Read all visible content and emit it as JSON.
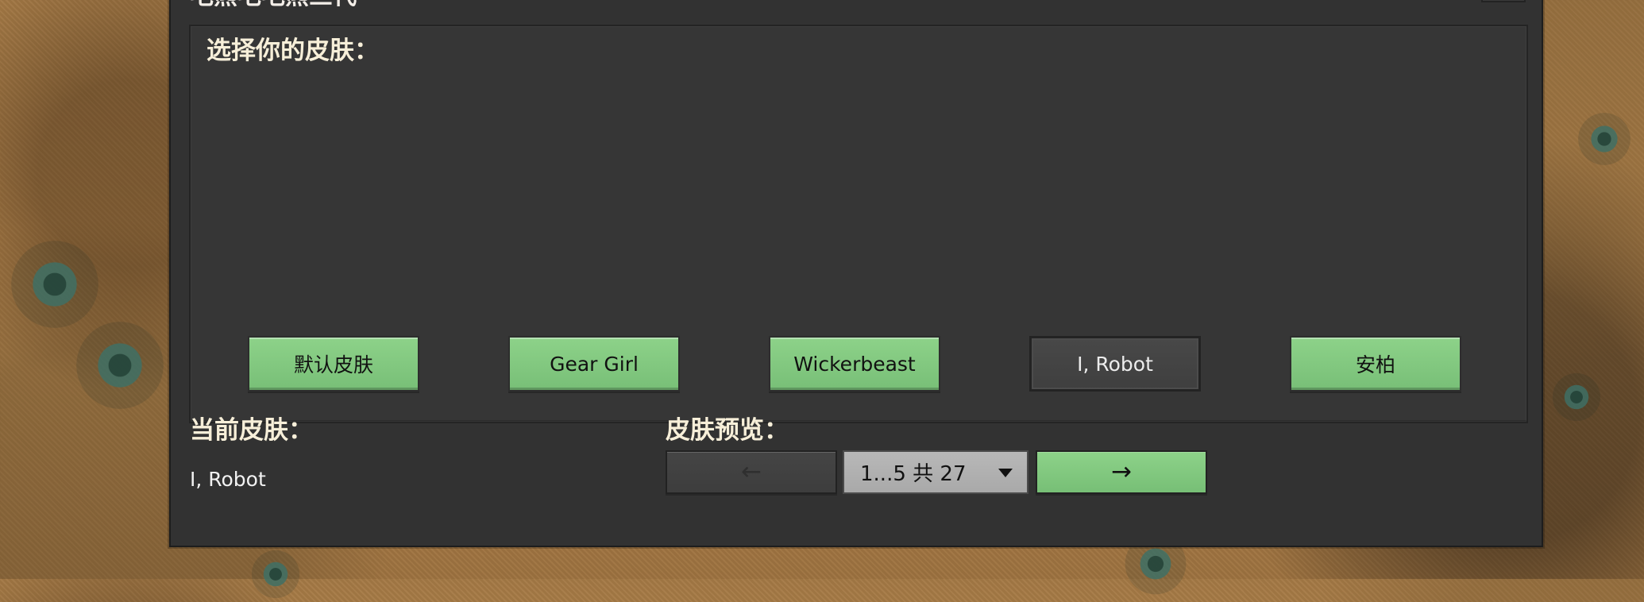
{
  "window": {
    "title": "毛熊毛毛熊三代"
  },
  "selector": {
    "heading": "选择你的皮肤：",
    "skins": [
      {
        "label": "默认皮肤"
      },
      {
        "label": "Gear Girl"
      },
      {
        "label": "Wickerbeast"
      },
      {
        "label": "I, Robot"
      },
      {
        "label": "安柏"
      }
    ]
  },
  "status": {
    "current_skin_heading": "当前皮肤：",
    "current_skin_value": "I, Robot",
    "preview_heading": "皮肤预览："
  },
  "preview": {
    "prev_icon": "left-arrow-icon",
    "next_icon": "right-arrow-icon",
    "page_value": "1...5 共 27",
    "dropdown_icon": "dropdown-icon"
  },
  "colors": {
    "accent_green": "#7cc77c",
    "current_button_bg": "#434343",
    "window_bg": "#323232"
  }
}
